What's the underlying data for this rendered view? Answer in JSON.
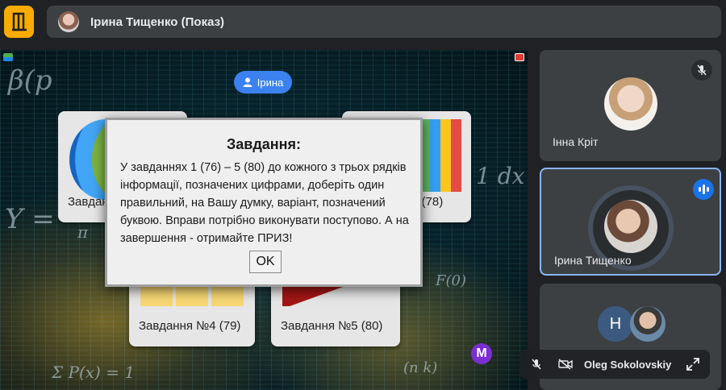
{
  "meeting": {
    "presenter_title": "Ірина Тищенко (Показ)"
  },
  "presentation": {
    "name_pill": "Ірина",
    "badge": "M",
    "cards": [
      {
        "label": "Завдан"
      },
      {
        "label": "3 (78)"
      },
      {
        "label": "Завдання №4 (79)"
      },
      {
        "label": "Завдання №5 (80)"
      }
    ],
    "dialog": {
      "title": "Завдання:",
      "body": "У завданнях 1 (76) – 5 (80) до кожного з трьох рядків інформації, позначених цифрами, доберіть один правильний, на Вашу думку, варіант, позначений буквою. Вправи потрібно виконувати поступово. А на завершення - отримайте ПРИЗ!",
      "ok_label": "OK"
    }
  },
  "participants": [
    {
      "name": "Інна Кріт",
      "status": "muted"
    },
    {
      "name": "Ірина Тищенко",
      "status": "speaking"
    },
    {
      "name": "Oleg Sokolovskiy",
      "initial": "H",
      "status": "muted"
    }
  ],
  "colors": {
    "accent": "#f9ab00",
    "speaking": "#1a73e8",
    "active_border": "#8ab4f8",
    "pill": "#3b82f0",
    "badge": "#7b2fd1"
  },
  "icons": [
    "door-exit-icon",
    "user-icon",
    "mic-off-icon",
    "audio-wave-icon",
    "camera-off-icon",
    "expand-icon"
  ]
}
